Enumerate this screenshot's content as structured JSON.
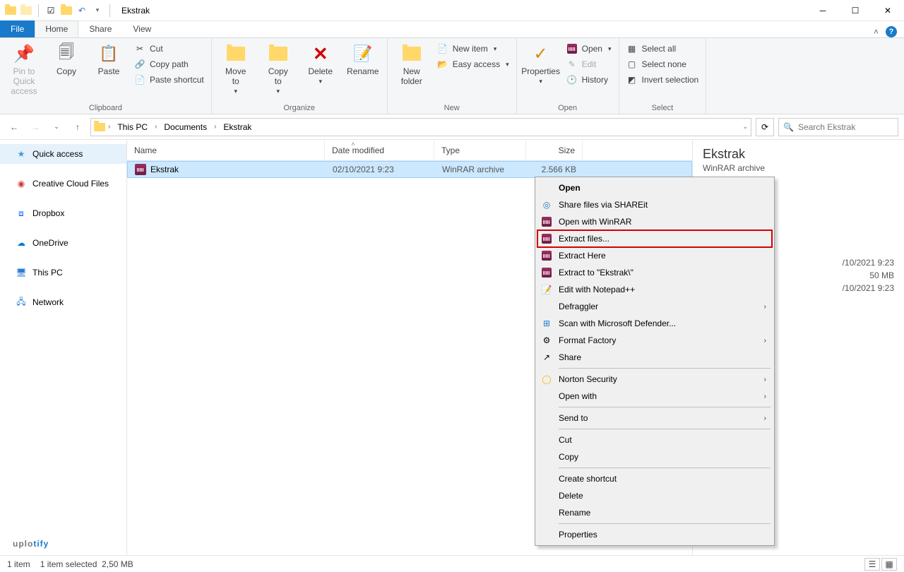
{
  "window": {
    "title": "Ekstrak"
  },
  "tabs": {
    "file": "File",
    "home": "Home",
    "share": "Share",
    "view": "View"
  },
  "ribbon": {
    "clipboard": {
      "pin": "Pin to Quick\naccess",
      "copy": "Copy",
      "paste": "Paste",
      "cut": "Cut",
      "copypath": "Copy path",
      "shortcut": "Paste shortcut",
      "label": "Clipboard"
    },
    "organize": {
      "moveto": "Move\nto",
      "copyto": "Copy\nto",
      "delete": "Delete",
      "rename": "Rename",
      "label": "Organize"
    },
    "new": {
      "folder": "New\nfolder",
      "item": "New item",
      "easy": "Easy access",
      "label": "New"
    },
    "open": {
      "properties": "Properties",
      "open": "Open",
      "edit": "Edit",
      "history": "History",
      "label": "Open"
    },
    "select": {
      "all": "Select all",
      "none": "Select none",
      "invert": "Invert selection",
      "label": "Select"
    }
  },
  "breadcrumb": {
    "p0": "This PC",
    "p1": "Documents",
    "p2": "Ekstrak"
  },
  "search": {
    "placeholder": "Search Ekstrak"
  },
  "columns": {
    "name": "Name",
    "date": "Date modified",
    "type": "Type",
    "size": "Size"
  },
  "sidebar": {
    "quick": "Quick access",
    "creative": "Creative Cloud Files",
    "dropbox": "Dropbox",
    "onedrive": "OneDrive",
    "thispc": "This PC",
    "network": "Network"
  },
  "files": [
    {
      "name": "Ekstrak",
      "date": "02/10/2021 9:23",
      "type": "WinRAR archive",
      "size": "2.566 KB"
    }
  ],
  "details": {
    "title": "Ekstrak",
    "sub": "WinRAR archive",
    "row1": "/10/2021 9:23",
    "row2": "50 MB",
    "row3": "/10/2021 9:23"
  },
  "context_menu": {
    "open": "Open",
    "shareit": "Share files via SHAREit",
    "openwr": "Open with WinRAR",
    "extractfiles": "Extract files...",
    "extracthere": "Extract Here",
    "extractto": "Extract to \"Ekstrak\\\"",
    "notepad": "Edit with Notepad++",
    "defraggler": "Defraggler",
    "defender": "Scan with Microsoft Defender...",
    "formatfactory": "Format Factory",
    "share": "Share",
    "norton": "Norton Security",
    "openwith": "Open with",
    "sendto": "Send to",
    "cut": "Cut",
    "copy": "Copy",
    "createshortcut": "Create shortcut",
    "delete": "Delete",
    "rename": "Rename",
    "properties": "Properties"
  },
  "status": {
    "count": "1 item",
    "selected": "1 item selected",
    "size": "2,50 MB"
  },
  "watermark": {
    "a": "uplo",
    "b": "tify"
  }
}
